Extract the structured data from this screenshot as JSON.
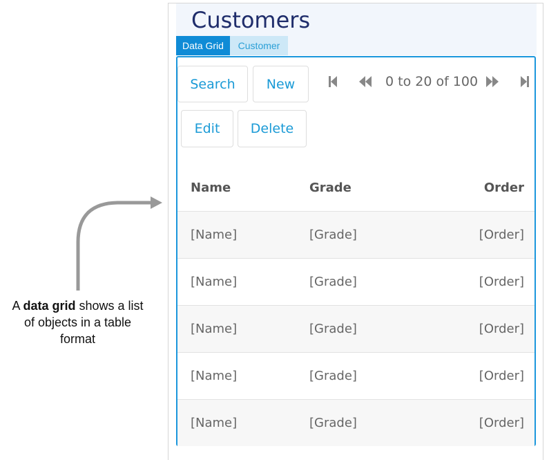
{
  "title": "Customers",
  "tabs": [
    "Data Grid",
    "Customer"
  ],
  "buttons": {
    "search": "Search",
    "new": "New",
    "edit": "Edit",
    "delete": "Delete"
  },
  "pager": {
    "text": "0 to 20 of 100"
  },
  "columns": [
    "Name",
    "Grade",
    "Order"
  ],
  "rows": [
    [
      "[Name]",
      "[Grade]",
      "[Order]"
    ],
    [
      "[Name]",
      "[Grade]",
      "[Order]"
    ],
    [
      "[Name]",
      "[Grade]",
      "[Order]"
    ],
    [
      "[Name]",
      "[Grade]",
      "[Order]"
    ],
    [
      "[Name]",
      "[Grade]",
      "[Order]"
    ]
  ],
  "annotation": {
    "prefix": "A ",
    "bold": "data grid",
    "suffix": " shows a list of objects in a table format"
  },
  "colors": {
    "accent": "#1a96dc",
    "tab_active": "#0f8bd6",
    "title": "#1f2d6b"
  }
}
